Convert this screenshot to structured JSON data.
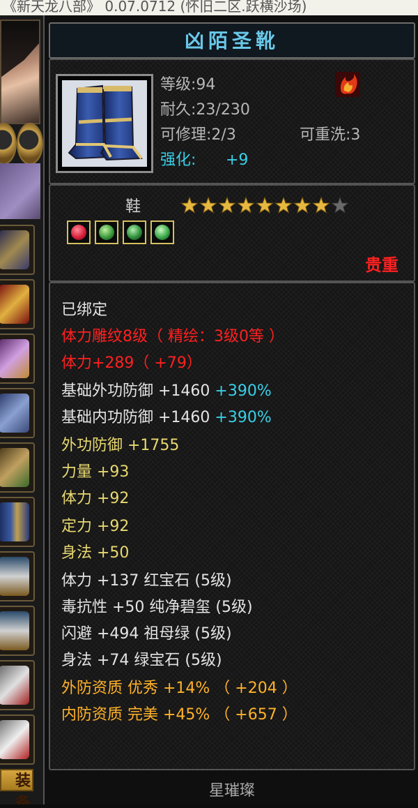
{
  "window_title": "《新天龙八部》 0.07.0712 (怀旧二区.跃横沙场)",
  "side_label": "装备",
  "item": {
    "name": "凶陌圣靴",
    "level": "等级:94",
    "durability": "耐久:23/230",
    "repairable": "可修理:2/3",
    "rewashable": "可重洗:3",
    "enhance_label": "强化:",
    "enhance_value": "+9",
    "type": "鞋",
    "stars_filled": 8,
    "stars_total": 9,
    "rarity": "贵重",
    "gems": [
      {
        "name": "red-gem",
        "color": "#d8203a"
      },
      {
        "name": "green-gem",
        "color": "#3c9a3c"
      },
      {
        "name": "green-gem",
        "color": "#2f8e3a"
      },
      {
        "name": "jade-gem",
        "color": "#3aa84a"
      }
    ],
    "bound": "已绑定",
    "engrave": "体力雕纹8级（ 精绘：3级0等 ）",
    "hp_line": "体力+289（ +79）",
    "base_ext_def": {
      "label": "基础外功防御  +1460",
      "bonus": "+390%"
    },
    "base_int_def": {
      "label": "基础内功防御  +1460",
      "bonus": "+390%"
    },
    "attrs": [
      "外功防御  +1755",
      "力量  +93",
      "体力  +92",
      "定力  +92",
      "身法  +50"
    ],
    "gem_attrs": [
      "体力  +137  红宝石 (5级)",
      "毒抗性  +50  纯净碧玺 (5级)",
      "闪避  +494  祖母绿 (5级)",
      "身法  +74  绿宝石 (5级)"
    ],
    "quality": [
      "外防资质    优秀  +14% （ +204 ）",
      "内防资质    完美  +45% （ +657 ）"
    ],
    "set_name": "星璀璨"
  },
  "colors": {
    "title": "#69c8e8",
    "engrave_red": "#ff2020",
    "attr_yellow": "#e8d870",
    "quality_orange": "#ffb22a",
    "bonus_cyan": "#39d0e8"
  }
}
